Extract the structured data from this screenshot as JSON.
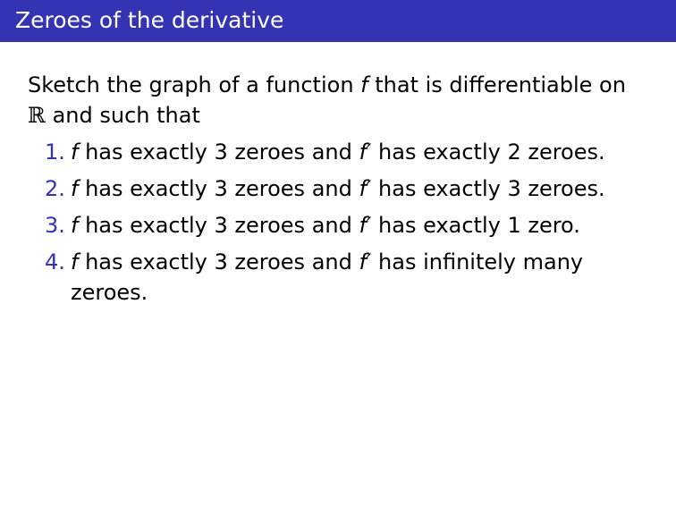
{
  "slide": {
    "title": "Zeroes of the derivative",
    "colors": {
      "title_bar": "#3333b3",
      "title_text": "#ffffff",
      "enumerate_number": "#3333b3"
    }
  },
  "body": {
    "intro": {
      "line1_before": "Sketch the graph of a function",
      "line1_var": "f",
      "line1_after": "that is differentiable on",
      "line2_set": "ℝ",
      "line2_after": "and such that"
    },
    "items": [
      {
        "number": "1.",
        "var": "f",
        "middle": "has exactly 3 zeroes and",
        "deriv": "f′",
        "end": "has exactly 2 zeroes."
      },
      {
        "number": "2.",
        "var": "f",
        "middle": "has exactly 3 zeroes and",
        "deriv": "f′",
        "end": "has exactly 3 zeroes."
      },
      {
        "number": "3.",
        "var": "f",
        "middle": "has exactly 3 zeroes and",
        "deriv": "f′",
        "end": "has exactly 1 zero."
      },
      {
        "number": "4.",
        "var": "f",
        "middle": "has exactly 3 zeroes and",
        "deriv": "f′",
        "end": "has infinitely many zeroes."
      }
    ]
  }
}
